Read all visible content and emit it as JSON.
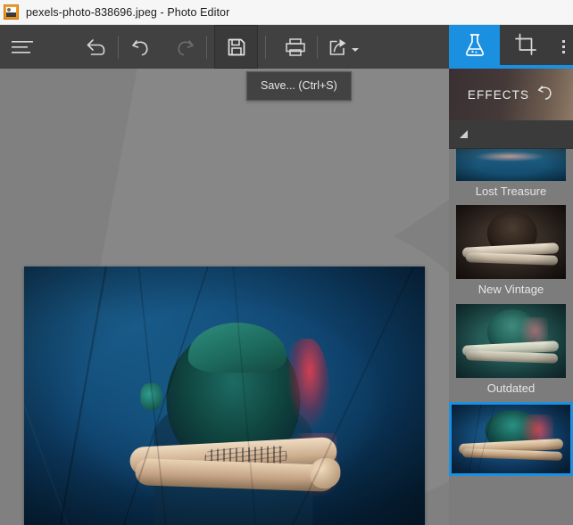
{
  "window": {
    "title": "pexels-photo-838696.jpeg - Photo Editor",
    "icon": "image-file-icon"
  },
  "toolbar": {
    "menu_label": "hamburger-menu-icon",
    "buttons": [
      {
        "name": "menu",
        "icon": "hamburger-menu-icon",
        "enabled": true
      },
      {
        "name": "revert",
        "icon": "revert-arrow-icon",
        "enabled": true
      },
      {
        "name": "undo",
        "icon": "undo-icon",
        "enabled": true
      },
      {
        "name": "redo",
        "icon": "redo-icon",
        "enabled": false
      },
      {
        "name": "save",
        "icon": "save-floppy-icon",
        "enabled": true,
        "active": true
      },
      {
        "name": "print",
        "icon": "printer-icon",
        "enabled": true
      },
      {
        "name": "share",
        "icon": "share-export-icon",
        "enabled": true,
        "has_dropdown": true
      }
    ]
  },
  "tooltip": {
    "text": "Save... (Ctrl+S)",
    "visible": true
  },
  "panel": {
    "tabs": [
      {
        "name": "effects",
        "icon": "flask-beaker-icon",
        "active": true
      },
      {
        "name": "crop",
        "icon": "crop-icon",
        "active": false
      },
      {
        "name": "more",
        "icon": "vertical-dots-icon",
        "active": false
      }
    ],
    "header": {
      "title": "EFFECTS",
      "reset_icon": "reset-undo-arrow-icon"
    },
    "scroll_up_indicator": "triangle-up-icon",
    "effects": [
      {
        "label": "Lost Treasure",
        "selected": false,
        "partial": true,
        "style": "th-lost"
      },
      {
        "label": "New Vintage",
        "selected": false,
        "partial": false,
        "style": "th-vintage"
      },
      {
        "label": "Outdated",
        "selected": false,
        "partial": false,
        "style": "th-outdated"
      },
      {
        "label": "",
        "selected": true,
        "partial": false,
        "style": "th-current"
      }
    ]
  },
  "canvas": {
    "image_alt": "Person with headphones and tattooed arms against a blue wall"
  },
  "colors": {
    "accent_blue": "#1b8fe0",
    "toolbar_bg": "#414141",
    "canvas_bg": "#808080",
    "panel_bg": "#7c7c7c",
    "titlebar_bg": "#f6f6f6",
    "tooltip_bg": "#424242"
  }
}
